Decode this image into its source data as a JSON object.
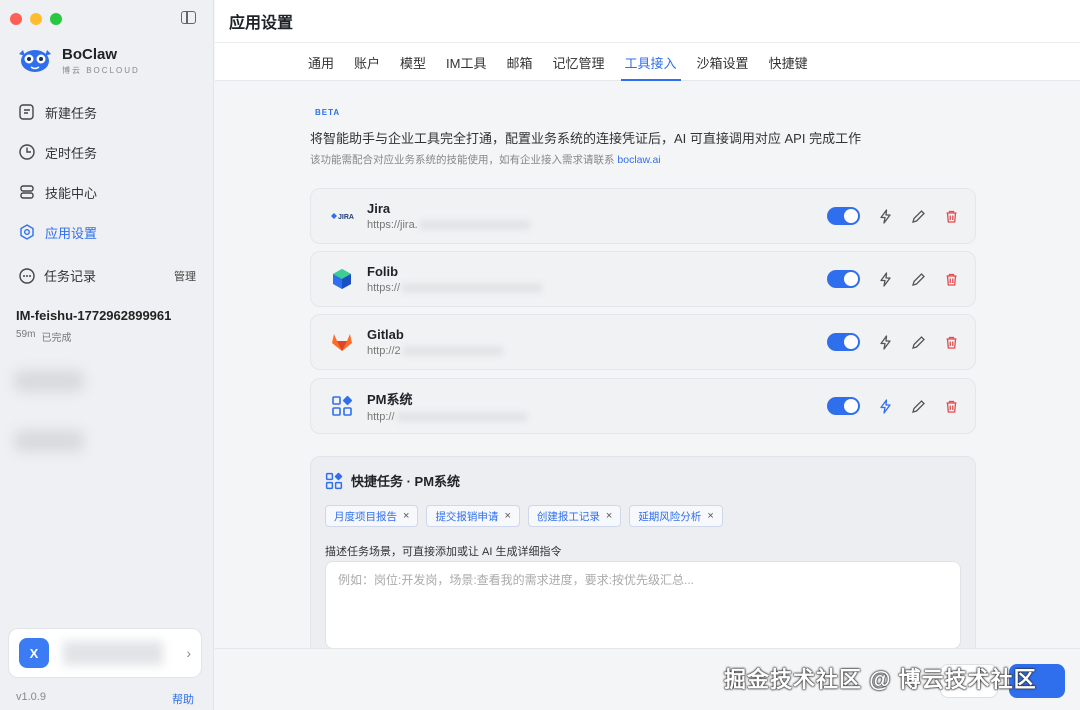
{
  "app": {
    "name": "BoClaw",
    "sub": "博云 BOCLOUD"
  },
  "sidebar": {
    "nav": [
      {
        "label": "新建任务",
        "icon": "edit-icon"
      },
      {
        "label": "定时任务",
        "icon": "clock-icon"
      },
      {
        "label": "技能中心",
        "icon": "stack-icon"
      },
      {
        "label": "应用设置",
        "icon": "settings-icon"
      }
    ],
    "records_label": "任务记录",
    "records_manage": "管理",
    "record": {
      "title": "IM-feishu-1772962899961",
      "time": "59m",
      "status": "已完成"
    },
    "user_initial": "X",
    "version": "v1.0.9",
    "help": "帮助"
  },
  "header": {
    "title": "应用设置"
  },
  "tabs": [
    "通用",
    "账户",
    "模型",
    "IM工具",
    "邮箱",
    "记忆管理",
    "工具接入",
    "沙箱设置",
    "快捷键"
  ],
  "active_tab": "工具接入",
  "intro": {
    "badge": "BETA",
    "desc": "将智能助手与企业工具完全打通，配置业务系统的连接凭证后，AI 可直接调用对应 API 完成工作",
    "sub": "该功能需配合对应业务系统的技能使用，如有企业接入需求请联系",
    "link": "boclaw.ai"
  },
  "tools": [
    {
      "name": "Jira",
      "url": "https://jira.",
      "enabled": true,
      "icon": "jira-icon"
    },
    {
      "name": "Folib",
      "url": "https://",
      "enabled": true,
      "icon": "folib-icon"
    },
    {
      "name": "Gitlab",
      "url": "http://2",
      "enabled": true,
      "icon": "gitlab-icon"
    },
    {
      "name": "PM系统",
      "url": "http://",
      "enabled": true,
      "icon": "apps-icon"
    }
  ],
  "quick": {
    "title": "快捷任务 · PM系统",
    "chips": [
      "月度项目报告",
      "提交报销申请",
      "创建报工记录",
      "延期风险分析"
    ],
    "hint": "描述任务场景，可直接添加或让 AI 生成详细指令",
    "placeholder": "例如：岗位:开发岗，场景:查看我的需求进度，要求:按优先级汇总..."
  },
  "watermark": "掘金技术社区 @ 博云技术社区",
  "colors": {
    "accent": "#2f6fed",
    "danger": "#e5484d"
  }
}
